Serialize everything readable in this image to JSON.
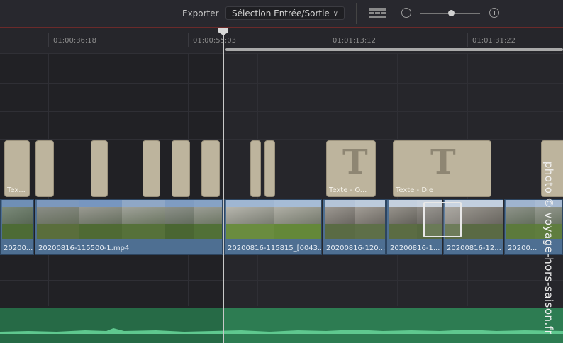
{
  "toolbar": {
    "export_label": "Exporter",
    "range_select_value": "Sélection Entrée/Sortie",
    "view_icon": "timeline-view-icon",
    "zoom_out_icon": "zoom-out-icon",
    "zoom_in_icon": "zoom-in-icon",
    "zoom_level": 0.5
  },
  "ruler": {
    "timecodes": [
      "01:00:36:18",
      "01:00:55:03",
      "01:01:13:12",
      "01:01:31:22"
    ]
  },
  "title_clips": [
    {
      "label": "Tex..."
    },
    {
      "label": ""
    },
    {
      "label": ""
    },
    {
      "label": ""
    },
    {
      "label": ""
    },
    {
      "label": ""
    },
    {
      "label": ""
    },
    {
      "label": ""
    },
    {
      "label": ""
    },
    {
      "label": "Texte - O..."
    },
    {
      "label": "Texte - Die"
    },
    {
      "label": ""
    }
  ],
  "video_clips": [
    {
      "label": "20200..."
    },
    {
      "label": "20200816-115500-1.mp4"
    },
    {
      "label": "20200816-115815_[0043..."
    },
    {
      "label": "20200816-120..."
    },
    {
      "label": "20200816-1..."
    },
    {
      "label": "20200816-12..."
    },
    {
      "label": "20200..."
    }
  ],
  "watermark": "photo © voyage-hors-saison.fr",
  "colors": {
    "title_clip": "#bdb49d",
    "video_clip": "#4e6f92",
    "audio_track": "#2d7c52",
    "playhead": "#d8d8d8"
  }
}
